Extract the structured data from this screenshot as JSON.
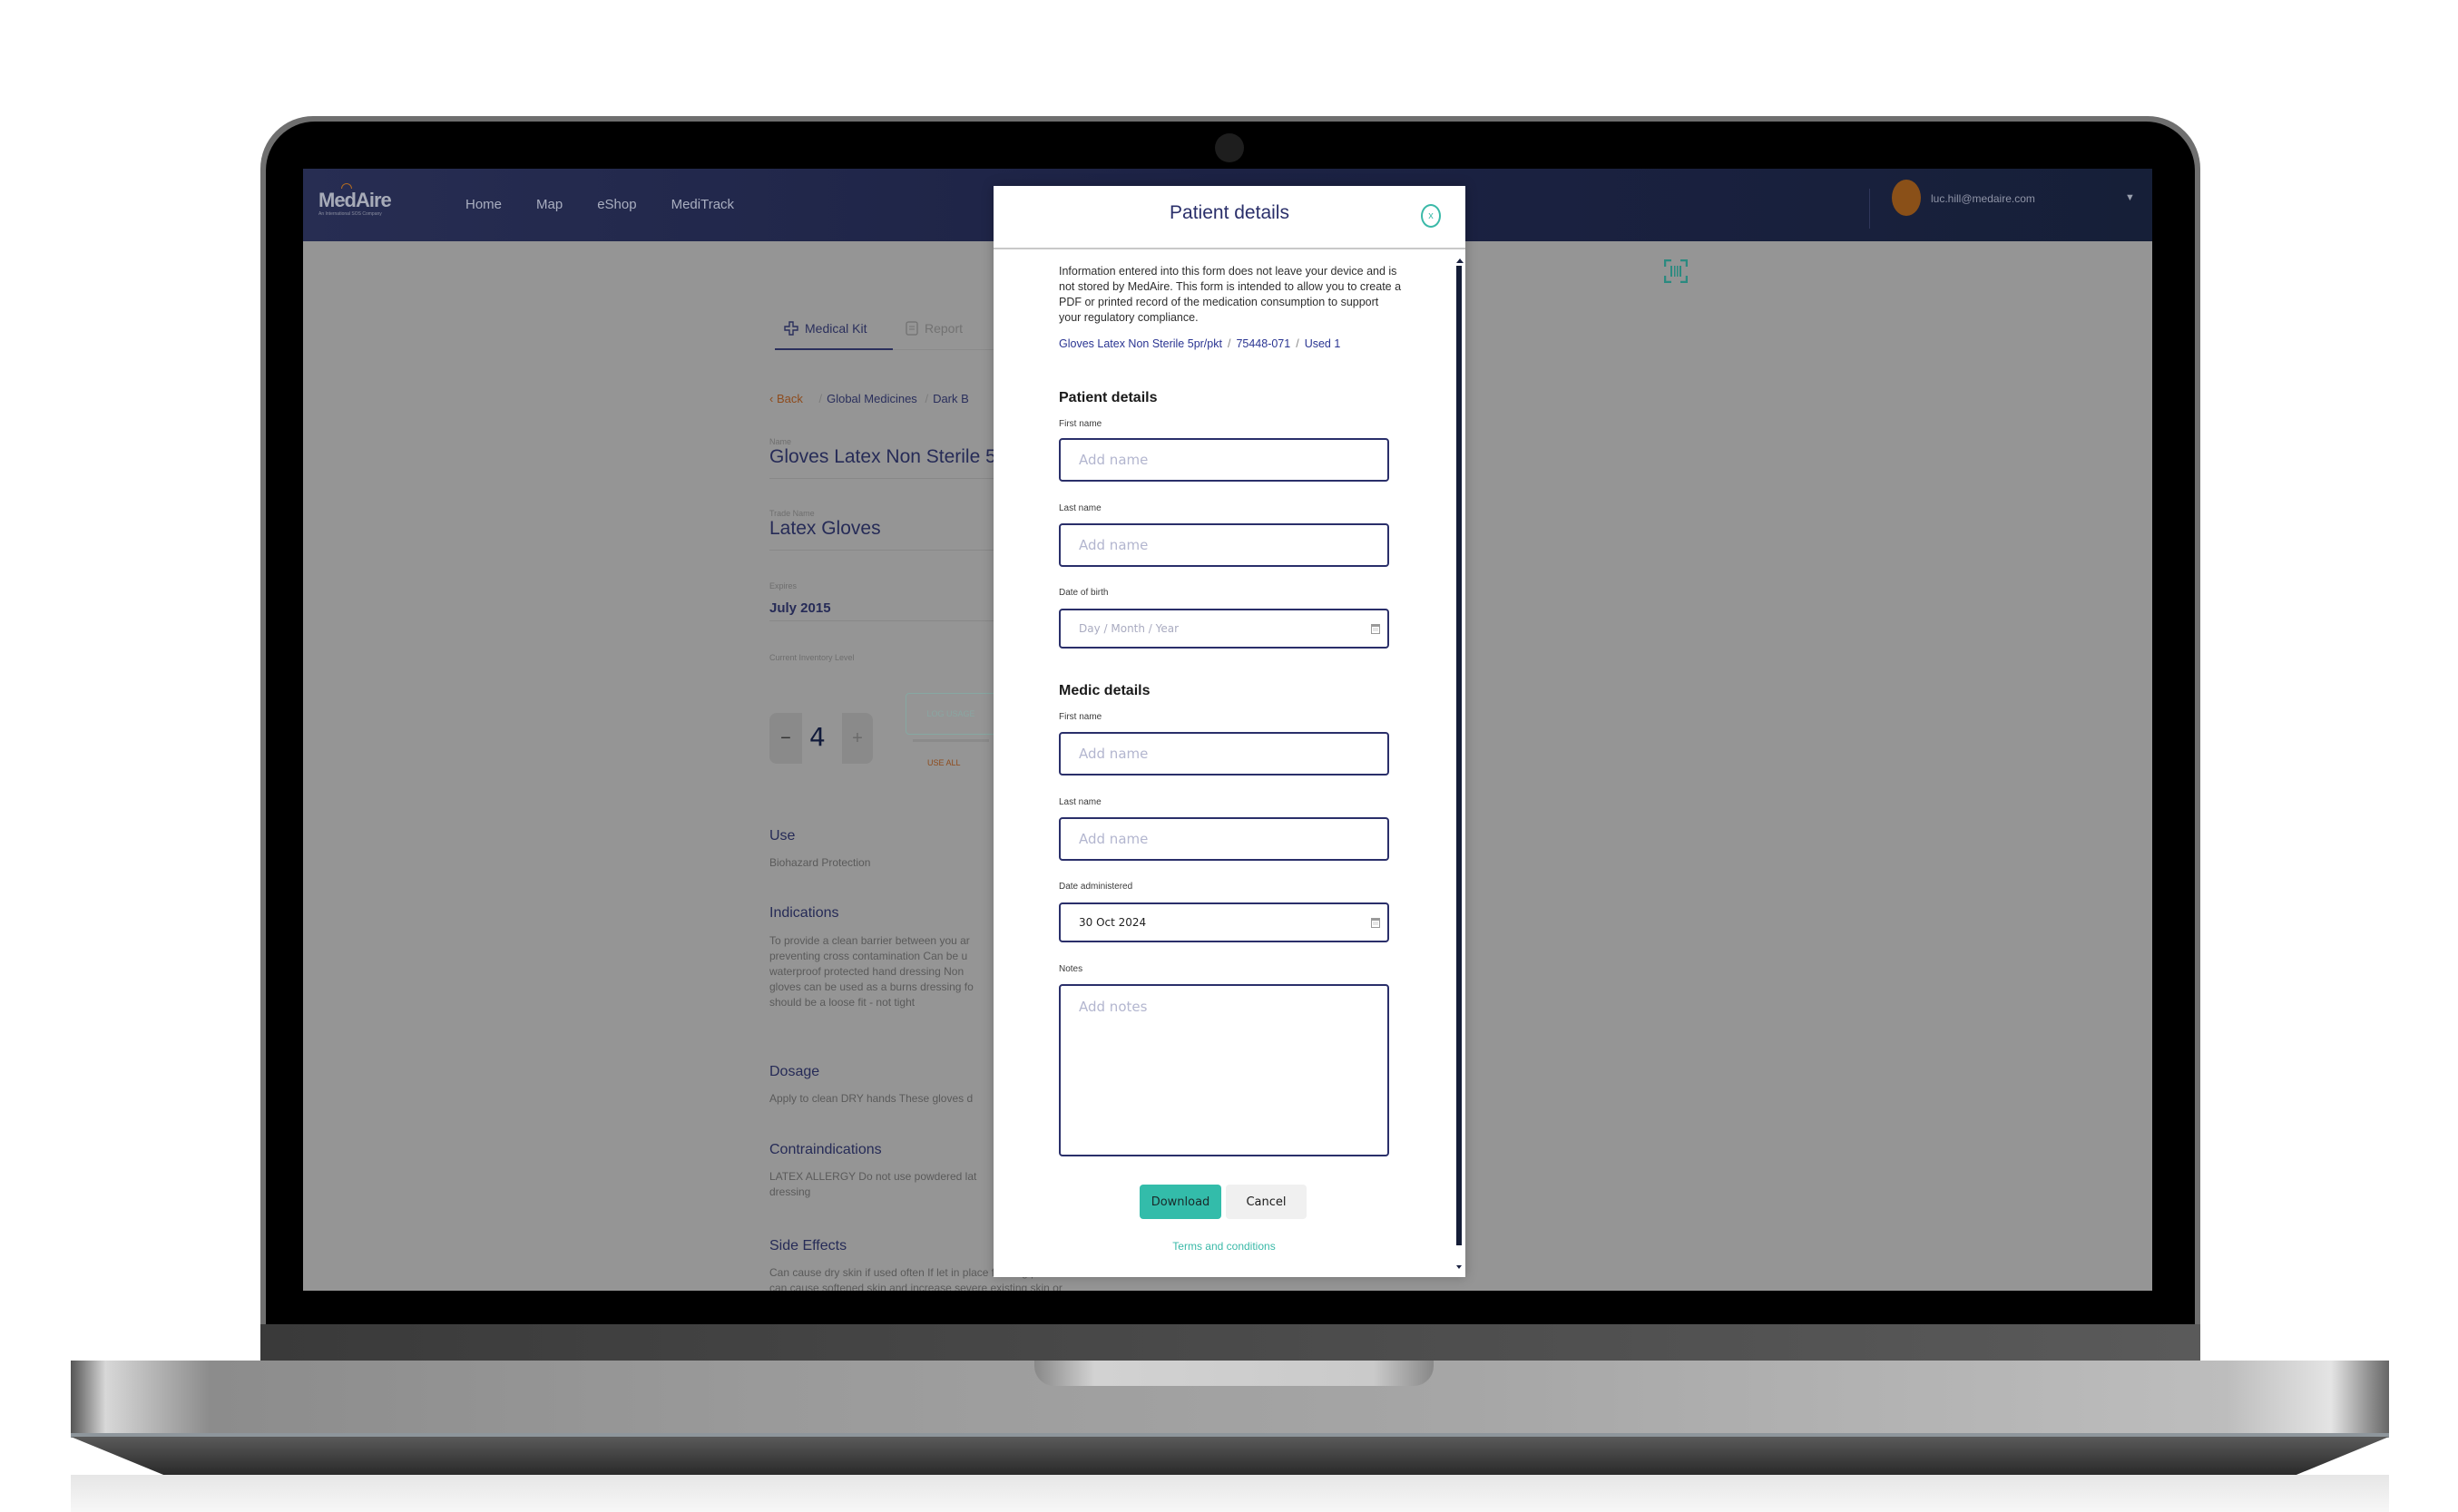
{
  "nav": {
    "logo": "MedAire",
    "logo_tagline": "An International SOS Company",
    "links": [
      "Home",
      "Map",
      "eShop",
      "MediTrack"
    ],
    "user_email": "luc.hill@medaire.com",
    "caret": "▼"
  },
  "tabs": {
    "medical_kit": "Medical Kit",
    "report": "Report"
  },
  "breadcrumb": {
    "back": "‹  Back",
    "items": [
      "Global Medicines",
      "Dark B"
    ]
  },
  "item": {
    "name_label": "Name",
    "name": "Gloves Latex Non Sterile 5",
    "trade_name_label": "Trade Name",
    "trade_name": "Latex Gloves",
    "expires_label": "Expires",
    "expires": "July 2015",
    "inventory_label": "Current Inventory Level",
    "inventory_value": "4",
    "minus": "−",
    "plus": "+",
    "log_usage": "LOG USAGE",
    "use_all": "USE ALL"
  },
  "sections": {
    "use_title": "Use",
    "use_text": "Biohazard Protection",
    "indications_title": "Indications",
    "indications_lines": [
      "To provide a clean barrier between you ar",
      "preventing cross contamination Can be u",
      "waterproof protected hand dressing Non",
      "gloves can be used as a burns dressing fo",
      "should be a loose fit - not tight"
    ],
    "dosage_title": "Dosage",
    "dosage_text": "Apply to clean DRY hands These gloves d",
    "contra_title": "Contraindications",
    "contra_lines": [
      "LATEX ALLERGY Do not use powdered lat",
      "dressing"
    ],
    "side_title": "Side Effects",
    "side_lines": [
      "Can cause dry skin if used often If let in place for long periods",
      "can cause softened skin and increase severe existing skin or"
    ]
  },
  "modal": {
    "title": "Patient details",
    "close": "x",
    "intro": "Information entered into this form does not leave your device and is not stored by MedAire. This form is intended to allow you to create a PDF or printed record of the medication consumption to support your regulatory compliance.",
    "meta": {
      "product": "Gloves Latex Non Sterile 5pr/pkt",
      "code": "75448-071",
      "used": "Used 1"
    },
    "patient_section": "Patient details",
    "patient_first_label": "First name",
    "patient_first_placeholder": "Add name",
    "patient_last_label": "Last name",
    "patient_last_placeholder": "Add name",
    "dob_label": "Date of birth",
    "dob_placeholder": "Day / Month / Year",
    "medic_section": "Medic details",
    "medic_first_label": "First name",
    "medic_first_placeholder": "Add name",
    "medic_last_label": "Last name",
    "medic_last_placeholder": "Add name",
    "date_admin_label": "Date administered",
    "date_admin_value": "30 Oct 2024",
    "notes_label": "Notes",
    "notes_placeholder": "Add notes",
    "download": "Download",
    "cancel": "Cancel",
    "terms": "Terms and conditions"
  },
  "colors": {
    "navy": "#2a2f6a",
    "teal": "#33bcaa",
    "orange": "#8e4b1c"
  }
}
